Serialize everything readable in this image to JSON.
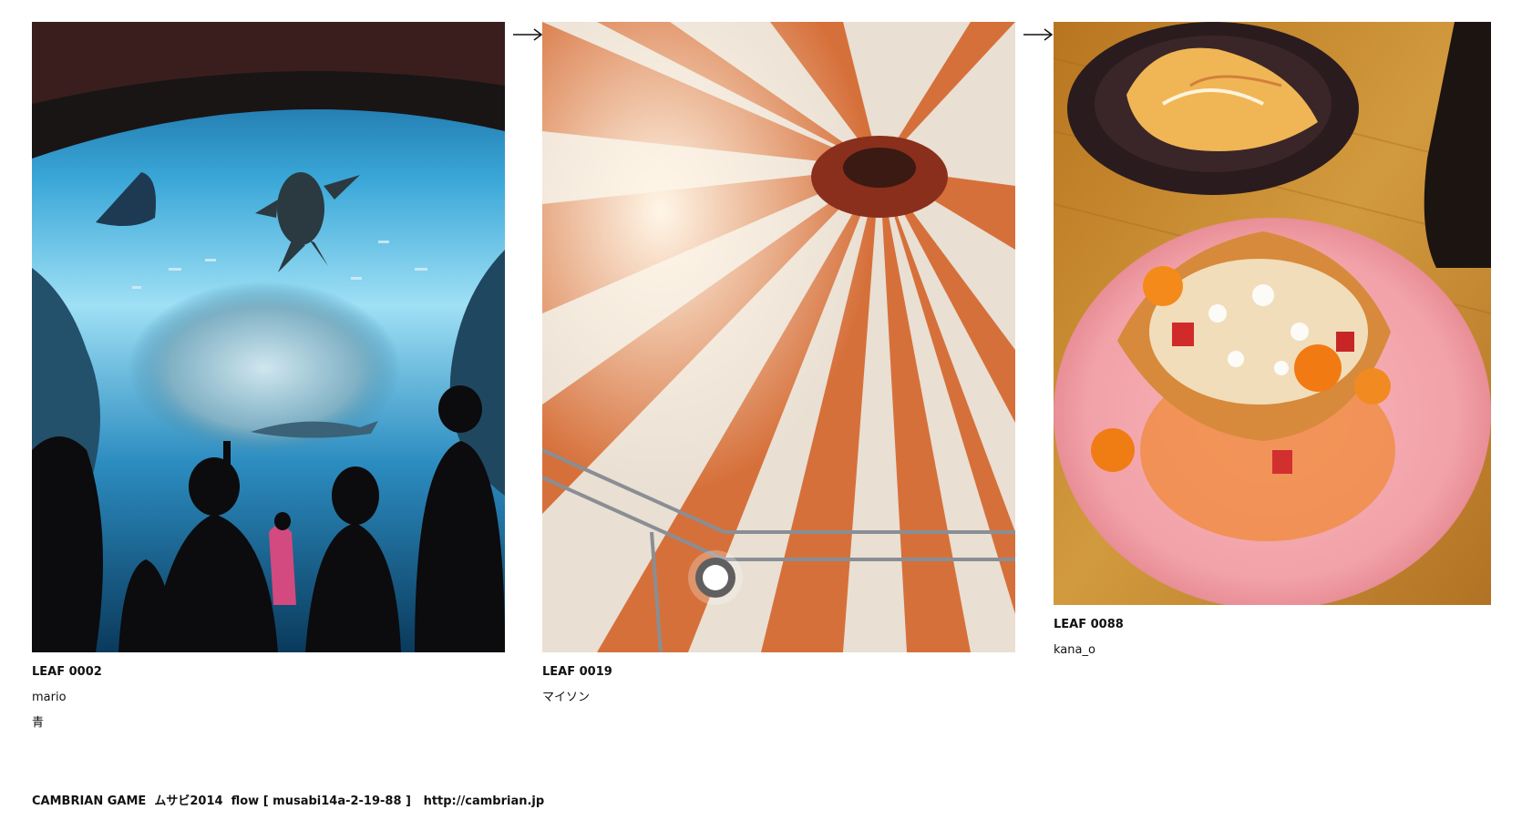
{
  "leaves": [
    {
      "id_label": "LEAF 0002",
      "author": "mario",
      "theme": "青",
      "photo_icon": "aquarium-photo"
    },
    {
      "id_label": "LEAF 0019",
      "author": "マイソン",
      "photo_icon": "circus-tent-photo"
    },
    {
      "id_label": "LEAF 0088",
      "author": "kana_o",
      "photo_icon": "dessert-photo"
    }
  ],
  "arrows": [
    "arrow-icon",
    "arrow-icon"
  ],
  "footer": {
    "text": "CAMBRIAN GAME  ムサビ2014  flow [ musabi14a-2-19-88 ]   ",
    "link": "http://cambrian.jp"
  },
  "colors": {
    "aquarium_water": "#2a8fc4",
    "tent_orange": "#d9733a",
    "tent_white": "#f2ece4",
    "table_wood": "#c9892f",
    "plate_pink": "#f3a7ad"
  }
}
